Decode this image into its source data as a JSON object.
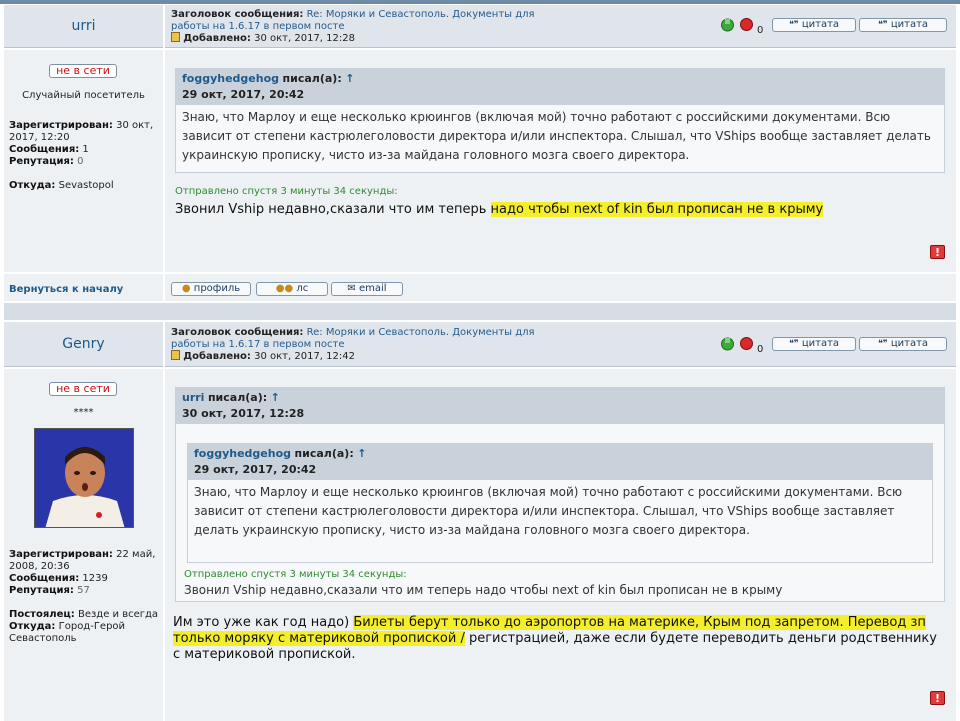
{
  "labels": {
    "subject": "Заголовок сообщения:",
    "added": "Добавлено:",
    "registered": "Зарегистрирован:",
    "posts": "Сообщения:",
    "reputation": "Репутация:",
    "from": "Откуда:",
    "resident": "Постоялец:",
    "wrote": "писал(а):",
    "sent_after": "Отправлено спустя 3 минуты 34 секунды:",
    "offline": "не в сети",
    "quote_btn": "цитата",
    "back_to_top": "Вернуться к началу",
    "profile": "профиль",
    "pm": "лс",
    "email": "email",
    "vote_count": "0",
    "arrow": "↑"
  },
  "thread_subject": {
    "prefix": "Re: Моряки и Севастополь. Документы для",
    "line2": "работы на 1.6.17 в первом посте"
  },
  "post1": {
    "author": "urri",
    "date": "30 окт, 2017, 12:28",
    "rank": "Случайный посетитель",
    "registered": "30 окт,",
    "registered2": "2017, 12:20",
    "posts": "1",
    "reputation": "0",
    "from": "Sevastopol",
    "quote": {
      "author": "foggyhedgehog",
      "date": "29 окт, 2017, 20:42",
      "text": "Знаю, что Марлоу и еще несколько крюингов (включая мой) точно работают с российскими документами. Всю зависит от степени кастрюлеголовости директора и/или инспектора. Слышал, что VShips вообще заставляет делать украинскую прописку, чисто из-за майдана головного мозга своего директора."
    },
    "body_plain": "Звонил Vship недавно,сказали что им теперь ",
    "body_hl": "надо чтобы next of kin был прописан не в крыму"
  },
  "post2": {
    "author": "Genry",
    "date": "30 окт, 2017, 12:42",
    "rank": "****",
    "registered": "22 май,",
    "registered2": "2008, 20:36",
    "posts": "1239",
    "reputation": "57",
    "resident": "Везде и всегда",
    "from": "Город-Герой",
    "from2": "Севастополь",
    "outer_quote": {
      "author": "urri",
      "date": "30 окт, 2017, 12:28"
    },
    "inner_quote": {
      "author": "foggyhedgehog",
      "date": "29 окт, 2017, 20:42",
      "text": "Знаю, что Марлоу и еще несколько крюингов (включая мой) точно работают с российскими документами. Всю зависит от степени кастрюлеголовости директора и/или инспектора. Слышал, что VShips вообще заставляет делать украинскую прописку, чисто из-за майдана головного мозга своего директора."
    },
    "quoted_reply": "Звонил Vship недавно,сказали что им теперь надо чтобы next of kin был прописан не в крыму",
    "body_a": "Им это уже как год надо) ",
    "body_hl": "Билеты берут только до аэропортов на материке, Крым под запретом. Перевод зп только моряку с материковой пропиской /",
    "body_b": " регистрацией, даже если будете переводить деньги родственнику с материковой пропиской."
  },
  "colors": {
    "highlight": "#f5ee2a",
    "link": "#1f5a8b",
    "offline": "#cc1111",
    "green_note": "#2e8b2e"
  }
}
